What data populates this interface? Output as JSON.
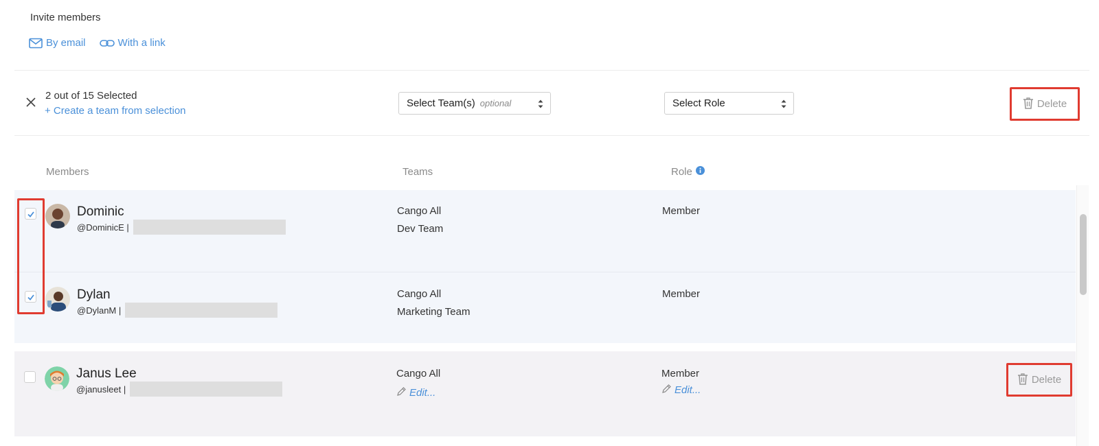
{
  "invite": {
    "title": "Invite members",
    "by_email": "By email",
    "with_link": "With a link"
  },
  "selection_bar": {
    "count_text": "2 out of 15 Selected",
    "create_team": "+ Create a team from selection",
    "team_select_label": "Select Team(s)",
    "team_select_hint": "optional",
    "role_select_label": "Select Role",
    "delete_label": "Delete"
  },
  "table": {
    "headers": {
      "members": "Members",
      "teams": "Teams",
      "role": "Role"
    },
    "rows": [
      {
        "name": "Dominic",
        "handle": "@DominicE |",
        "checked": true,
        "team_1": "Cango All",
        "team_2": "Dev Team",
        "role": "Member"
      },
      {
        "name": "Dylan",
        "handle": "@DylanM |",
        "checked": true,
        "team_1": "Cango All",
        "team_2": "Marketing Team",
        "role": "Member"
      },
      {
        "name": "Janus Lee",
        "handle": "@janusleet |",
        "checked": false,
        "team_1": "Cango All",
        "team_edit": "Edit...",
        "role": "Member",
        "role_edit": "Edit...",
        "delete_label": "Delete"
      }
    ]
  },
  "colors": {
    "accent": "#4a90d9",
    "highlight": "#e03b30",
    "selected_row_bg": "#f3f6fb",
    "hover_row_bg": "#f3f2f5"
  }
}
